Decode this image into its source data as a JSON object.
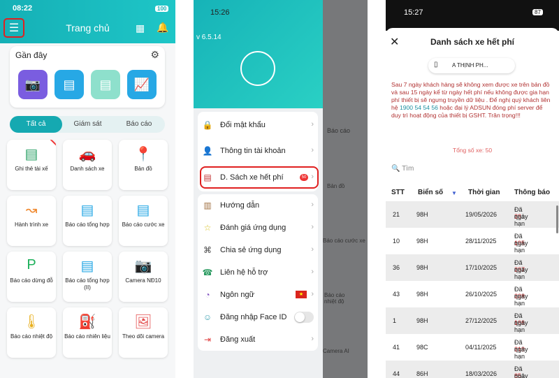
{
  "p1": {
    "time": "08:22",
    "battery": "100",
    "title": "Trang chủ",
    "recent": "Gần đây",
    "tabs": [
      "Tất cả",
      "Giám sát",
      "Báo cáo"
    ],
    "items": [
      "Ghi thẻ tài xế",
      "Danh sách xe",
      "Bản đồ",
      "Hành trình xe",
      "Báo cáo tổng hợp",
      "Báo cáo cước xe",
      "Báo cáo dừng đỗ",
      "Báo cáo tổng hợp (II)",
      "Camera NĐ10",
      "Báo cáo nhiệt độ",
      "Báo cáo nhiên liệu",
      "Theo dõi camera"
    ],
    "icons": [
      "id-card-icon",
      "car-icon",
      "map-pin-icon",
      "route-icon",
      "report-icon",
      "fee-report-icon",
      "parking-icon",
      "report-2-icon",
      "camera-icon",
      "thermometer-icon",
      "fuel-icon",
      "camera-view-icon"
    ]
  },
  "p2": {
    "time": "15:26",
    "battery": "88",
    "version": "v 6.5.14",
    "badge": "50",
    "menu": [
      "Đổi mật khẩu",
      "Thông tin tài khoản",
      "D. Sách xe hết phí",
      "Hướng dẫn",
      "Đánh giá ứng dụng",
      "Chia sẻ ứng dụng",
      "Liên hệ hỗ trợ",
      "Ngôn ngữ",
      "Đăng nhập Face ID",
      "Đăng xuất"
    ],
    "bg": [
      "Báo cáo",
      "Bản đồ",
      "Báo cáo cước xe",
      "Báo cáo nhiệt độ",
      "Camera AI"
    ]
  },
  "p3": {
    "time": "15:27",
    "battery": "87",
    "title": "Danh sách xe hết phí",
    "chip": "A THỊNH PH...",
    "notice_a": "Sau 7 ngày khách hàng sẽ không xem được xe trên bản đồ và sau 15 ngày kể từ ngày hết phí nếu không được gia hạn phí thiết bị sẽ ngưng truyền dữ liệu . Để nghị quý khách liên hệ ",
    "phone": "1900 54 54 56",
    "notice_b": " hoặc đại lý ADSUN đóng phí server để duy trì hoạt động của thiết bị GSHT. Trân trọng!!!",
    "total": "Tổng số xe: 50",
    "search": "Tìm",
    "headers": [
      "STT",
      "Biển số",
      "Thời gian",
      "Thông báo"
    ],
    "expired": "Đã quá hạn",
    "days_unit": "ngày",
    "rows": [
      [
        "21",
        "98H",
        "19/05/2026",
        "23"
      ],
      [
        "10",
        "98H",
        "28/11/2025",
        "195"
      ],
      [
        "36",
        "98H",
        "17/10/2025",
        "237"
      ],
      [
        "43",
        "98H",
        "26/10/2025",
        "228"
      ],
      [
        "1",
        "98H",
        "27/12/2025",
        "166"
      ],
      [
        "41",
        "98C",
        "04/11/2025",
        "219"
      ],
      [
        "44",
        "86H",
        "18/03/2026",
        "85"
      ]
    ]
  }
}
